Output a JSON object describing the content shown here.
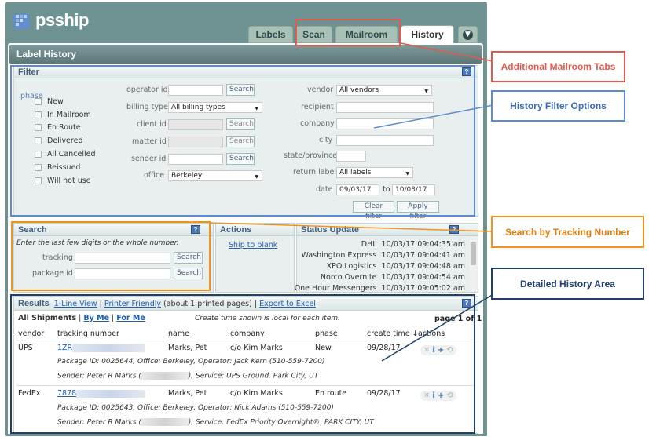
{
  "app": {
    "logo_text": "psship"
  },
  "tabs": [
    {
      "label": "Labels"
    },
    {
      "label": "Scan"
    },
    {
      "label": "Mailroom"
    },
    {
      "label": "History"
    }
  ],
  "page_title": "Label History",
  "filter": {
    "title": "Filter",
    "help": "?",
    "phase_label": "phase",
    "phases": [
      "New",
      "In Mailroom",
      "En Route",
      "Delivered",
      "All Cancelled",
      "Reissued",
      "Will not use"
    ],
    "operator_label": "operator id",
    "operator_search": "Search",
    "billing_label": "billing type",
    "billing_value": "All billing types",
    "client_label": "client id",
    "client_search": "Search",
    "matter_label": "matter id",
    "matter_search": "Search",
    "sender_label": "sender id",
    "sender_search": "Search",
    "office_label": "office",
    "office_value": "Berkeley",
    "vendor_label": "vendor",
    "vendor_value": "All vendors",
    "recipient_label": "recipient",
    "company_label": "company",
    "city_label": "city",
    "state_label": "state/province",
    "return_label": "return label",
    "return_value": "All labels",
    "date_label": "date",
    "date_from": "09/03/17",
    "date_to_label": "to",
    "date_to": "10/03/17",
    "clear_btn": "Clear filter",
    "apply_btn": "Apply filter"
  },
  "search": {
    "title": "Search",
    "hint": "Enter the last few digits or the whole number.",
    "tracking_label": "tracking",
    "tracking_btn": "Search",
    "package_label": "package id",
    "package_btn": "Search"
  },
  "actions": {
    "title": "Actions",
    "link": "Ship to blank"
  },
  "status_update": {
    "title": "Status Update",
    "rows": [
      {
        "carrier": "DHL",
        "time": "10/03/17 09:04:35 am"
      },
      {
        "carrier": "Washington Express",
        "time": "10/03/17 09:04:41 am"
      },
      {
        "carrier": "XPO Logistics",
        "time": "10/03/17 09:04:48 am"
      },
      {
        "carrier": "Norco Overnite",
        "time": "10/03/17 09:04:54 am"
      },
      {
        "carrier": "One Hour Messengers",
        "time": "10/03/17 09:05:02 am"
      }
    ]
  },
  "results": {
    "title": "Results",
    "one_line": "1-Line View",
    "printer": "Printer Friendly",
    "pages_note": "(about 1 printed pages)",
    "export": "Export to Excel",
    "all_shipments": "All Shipments",
    "by_me": "By Me",
    "for_me": "For Me",
    "local_note": "Create time shown is local for each item.",
    "page_info": "page 1 of 1",
    "columns": [
      "vendor",
      "tracking number",
      "name",
      "company",
      "phase",
      "create time ↓",
      "actions"
    ],
    "rows": [
      {
        "vendor": "UPS",
        "tracking": "1ZR",
        "name": "Marks, Pet",
        "company": "c/o Kim Marks",
        "phase": "New",
        "created": "09/28/17",
        "detail1": "Package ID: 0025644, Office: Berkeley, Operator: Jack Kern (510-559-7200)",
        "sender_prefix": "Sender: Peter R Marks (",
        "sender_suffix": "), Service: UPS Ground, Park City, UT"
      },
      {
        "vendor": "FedEx",
        "tracking": "7878",
        "name": "Marks, Pet",
        "company": "c/o Kim Marks",
        "phase": "En route",
        "created": "09/28/17",
        "detail1": "Package ID: 0025643, Office: Berkeley, Operator: Nick Adams (510-559-7200)",
        "sender_prefix": "Sender: Peter R Marks (",
        "sender_suffix": "), Service: FedEx Priority Overnight®, PARK CITY, UT"
      }
    ]
  },
  "annotations": [
    {
      "label": "Additional Mailroom Tabs",
      "color": "#e05a4f"
    },
    {
      "label": "History Filter Options",
      "color": "#5b8bd0"
    },
    {
      "label": "Search by Tracking Number",
      "color": "#f0921e"
    },
    {
      "label": "Detailed History Area",
      "color": "#1f3f6e"
    }
  ]
}
